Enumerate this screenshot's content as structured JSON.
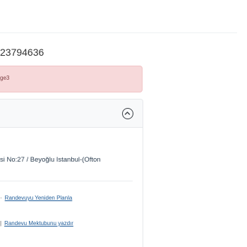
{
  "appointment": {
    "reference_number": "23794636",
    "alert_text": "ge3",
    "address": "si No:27 / Beyoğlu Istanbul-(Ofton",
    "actions": [
      {
        "bullet": "·",
        "label": "Randevuyu Yeniden Planla"
      },
      {
        "bullet": "|",
        "label": "Randevu Mektubunu yazdır"
      }
    ]
  },
  "icons": {
    "collapse": "chevron-up-circle-icon"
  },
  "colors": {
    "alert_background": "#f7d9da",
    "link": "#1f5c99"
  }
}
